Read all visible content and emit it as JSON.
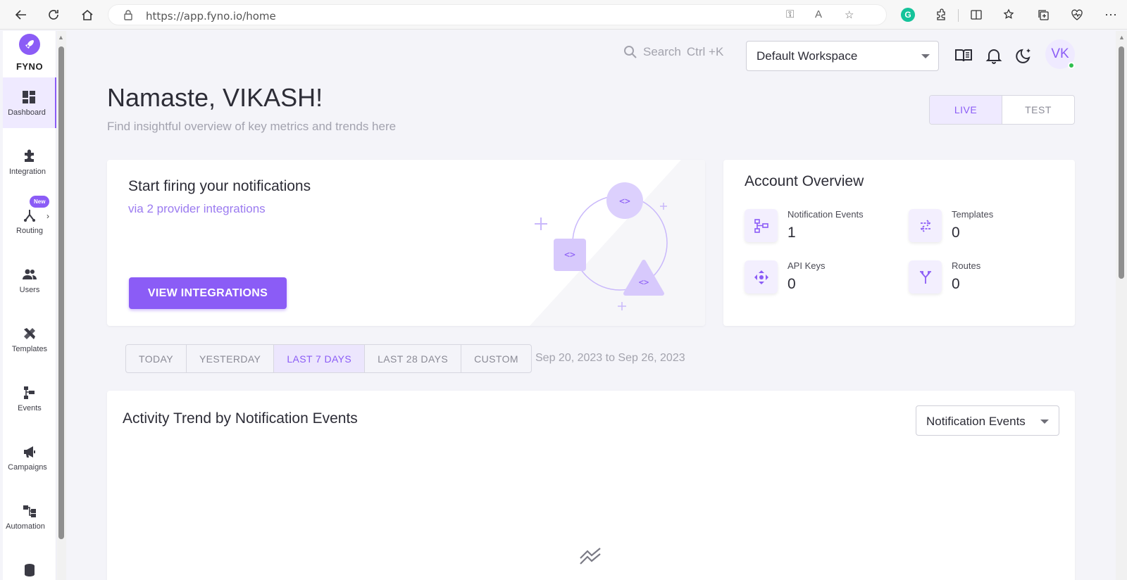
{
  "browser": {
    "url": "https://app.fyno.io/home"
  },
  "brand": {
    "name": "FYNO",
    "accent": "#8b5cf6"
  },
  "sidebar": {
    "items": [
      {
        "label": "Dashboard",
        "icon": "dashboard-icon",
        "active": true
      },
      {
        "label": "Integration",
        "icon": "puzzle-icon"
      },
      {
        "label": "Routing",
        "icon": "routing-icon",
        "badge": "New"
      },
      {
        "label": "Users",
        "icon": "users-icon"
      },
      {
        "label": "Templates",
        "icon": "templates-icon"
      },
      {
        "label": "Events",
        "icon": "events-icon"
      },
      {
        "label": "Campaigns",
        "icon": "megaphone-icon"
      },
      {
        "label": "Automation",
        "icon": "automation-icon"
      }
    ]
  },
  "header": {
    "search_label": "Search",
    "search_shortcut": "Ctrl +K",
    "workspace": "Default Workspace",
    "avatar_initials": "VK"
  },
  "greeting": {
    "title": "Namaste, VIKASH!",
    "subtitle": "Find insightful overview of key metrics and trends here"
  },
  "env": {
    "options": [
      "LIVE",
      "TEST"
    ],
    "selected": "LIVE"
  },
  "fire_card": {
    "title": "Start firing your notifications",
    "subtitle": "via 2 provider integrations",
    "button": "VIEW INTEGRATIONS"
  },
  "account": {
    "title": "Account Overview",
    "stats": [
      {
        "label": "Notification Events",
        "value": "1",
        "icon": "tree-icon"
      },
      {
        "label": "Templates",
        "value": "0",
        "icon": "swap-arrows-icon"
      },
      {
        "label": "API Keys",
        "value": "0",
        "icon": "move-arrows-icon"
      },
      {
        "label": "Routes",
        "value": "0",
        "icon": "fork-arrow-icon"
      }
    ]
  },
  "date_range": {
    "options": [
      "TODAY",
      "YESTERDAY",
      "LAST 7 DAYS",
      "LAST 28 DAYS",
      "CUSTOM"
    ],
    "selected": "LAST 7 DAYS",
    "range_text": "Sep 20, 2023 to Sep 26, 2023"
  },
  "activity": {
    "title": "Activity Trend by Notification Events",
    "select_value": "Notification Events"
  }
}
